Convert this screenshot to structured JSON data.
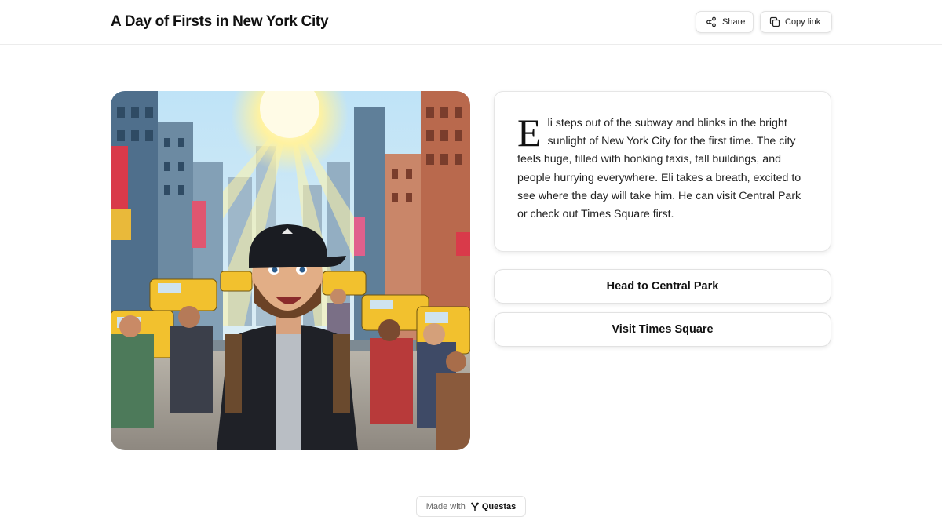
{
  "header": {
    "title": "A Day of Firsts in New York City",
    "share_label": "Share",
    "copy_link_label": "Copy link"
  },
  "story": {
    "drop_cap": "E",
    "text": "li steps out of the subway and blinks in the bright sunlight of New York City for the first time. The city feels huge, filled with honking taxis, tall buildings, and people hurrying everywhere. Eli takes a breath, excited to see where the day will take him. He can visit Central Park or check out Times Square first."
  },
  "choices": [
    {
      "label": "Head to Central Park"
    },
    {
      "label": "Visit Times Square"
    }
  ],
  "footer": {
    "made_with": "Made with",
    "brand": "Questas"
  },
  "colors": {
    "taxi_yellow": "#f2c12e",
    "sky_blue": "#9fd3f2",
    "sun": "#fff6b0",
    "card_border": "#e6e6e6"
  },
  "icons": {
    "share": "share-icon",
    "copy": "copy-icon",
    "brand": "questas-logo-icon"
  }
}
